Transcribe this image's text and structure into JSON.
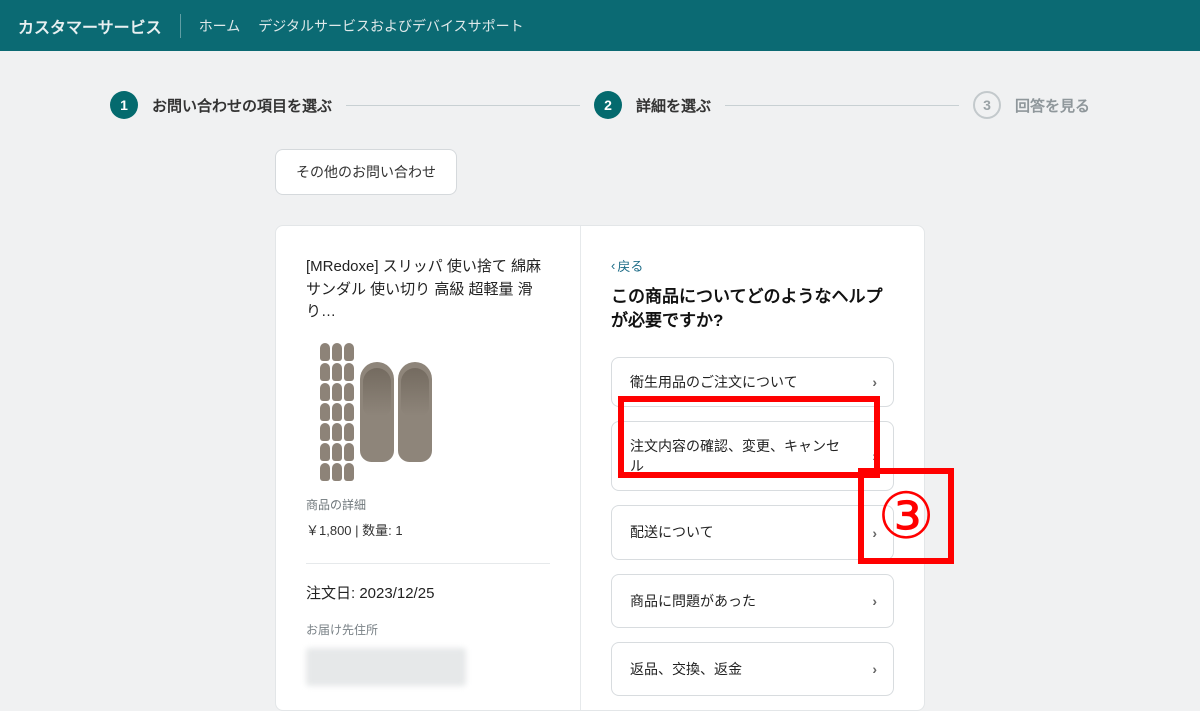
{
  "topbar": {
    "service": "カスタマーサービス",
    "home": "ホーム",
    "digital": "デジタルサービスおよびデバイスサポート"
  },
  "steps": {
    "s1_num": "1",
    "s1_label": "お問い合わせの項目を選ぶ",
    "s2_num": "2",
    "s2_label": "詳細を選ぶ",
    "s3_num": "3",
    "s3_label": "回答を見る"
  },
  "other_btn": "その他のお問い合わせ",
  "product": {
    "title": "[MRedoxe] スリッパ 使い捨て 綿麻 サンダル 使い切り 高級 超軽量 滑り…",
    "details_label": "商品の詳細",
    "price": "￥1,800",
    "qty_sep": " | ",
    "qty_label": "数量: ",
    "qty_value": "1"
  },
  "order": {
    "date_line": "注文日: 2023/12/25",
    "addr_label": "お届け先住所"
  },
  "right": {
    "back": "戻る",
    "question": "この商品についてどのようなヘルプが必要ですか?",
    "options": {
      "o1": "衛生用品のご注文について",
      "o2": "注文内容の確認、変更、キャンセル",
      "o3": "配送について",
      "o4": "商品に問題があった",
      "o5": "返品、交換、返金"
    }
  },
  "annotation_number": "③"
}
